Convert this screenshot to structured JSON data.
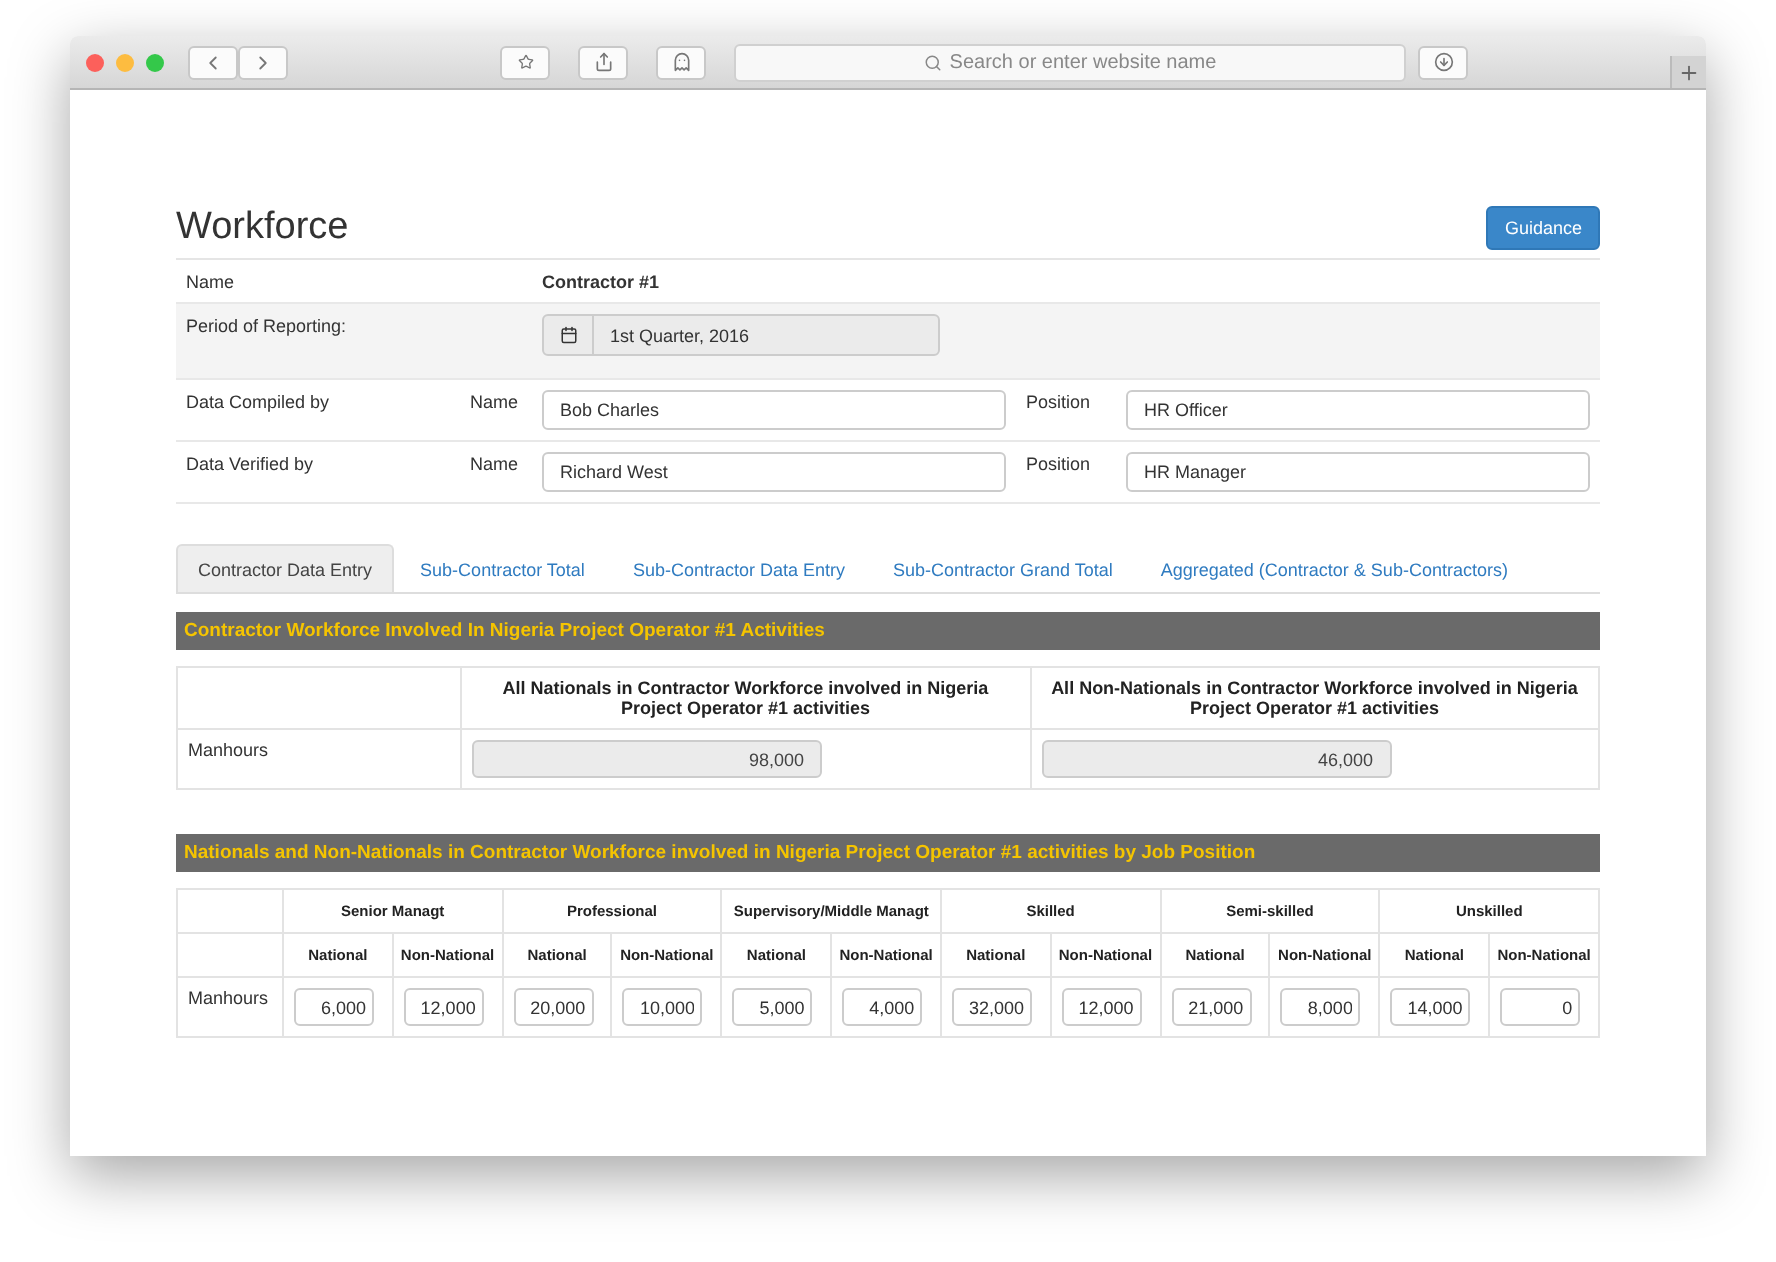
{
  "browser": {
    "search_placeholder": "Search or enter website name"
  },
  "page": {
    "title": "Workforce",
    "guidance_button": "Guidance"
  },
  "info": {
    "name_label": "Name",
    "name_value": "Contractor #1",
    "period_label": "Period of Reporting:",
    "period_value": "1st Quarter, 2016",
    "people": [
      {
        "label": "Data Compiled by",
        "name_label": "Name",
        "name_value": "Bob Charles",
        "position_label": "Position",
        "position_value": "HR Officer"
      },
      {
        "label": "Data Verified by",
        "name_label": "Name",
        "name_value": "Richard West",
        "position_label": "Position",
        "position_value": "HR Manager"
      }
    ]
  },
  "tabs": [
    {
      "label": "Contractor Data Entry",
      "selected": true
    },
    {
      "label": "Sub-Contractor Total",
      "selected": false
    },
    {
      "label": "Sub-Contractor Data Entry",
      "selected": false
    },
    {
      "label": "Sub-Contractor Grand Total",
      "selected": false
    },
    {
      "label": "Aggregated (Contractor & Sub-Contractors)",
      "selected": false
    }
  ],
  "summary": {
    "title": "Contractor Workforce Involved In Nigeria Project Operator #1 Activities",
    "columns": [
      "All Nationals in Contractor Workforce involved in Nigeria Project Operator #1 activities",
      "All Non-Nationals in Contractor Workforce involved in Nigeria Project Operator #1 activities"
    ],
    "row_label": "Manhours",
    "values": [
      "98,000",
      "46,000"
    ]
  },
  "by_position": {
    "title": "Nationals and Non-Nationals in Contractor Workforce involved in Nigeria Project Operator #1 activities by Job Position",
    "row_label": "Manhours",
    "groups": [
      {
        "name": "Senior Managt",
        "national_label": "National",
        "non_national_label": "Non-National",
        "national": "6,000",
        "non_national": "12,000"
      },
      {
        "name": "Professional",
        "national_label": "National",
        "non_national_label": "Non-National",
        "national": "20,000",
        "non_national": "10,000"
      },
      {
        "name": "Supervisory/Middle Managt",
        "national_label": "National",
        "non_national_label": "Non-National",
        "national": "5,000",
        "non_national": "4,000"
      },
      {
        "name": "Skilled",
        "national_label": "National",
        "non_national_label": "Non-National",
        "national": "32,000",
        "non_national": "12,000"
      },
      {
        "name": "Semi-skilled",
        "national_label": "National",
        "non_national_label": "Non-National",
        "national": "21,000",
        "non_national": "8,000"
      },
      {
        "name": "Unskilled",
        "national_label": "National",
        "non_national_label": "Non-National",
        "national": "14,000",
        "non_national": "0"
      }
    ]
  }
}
